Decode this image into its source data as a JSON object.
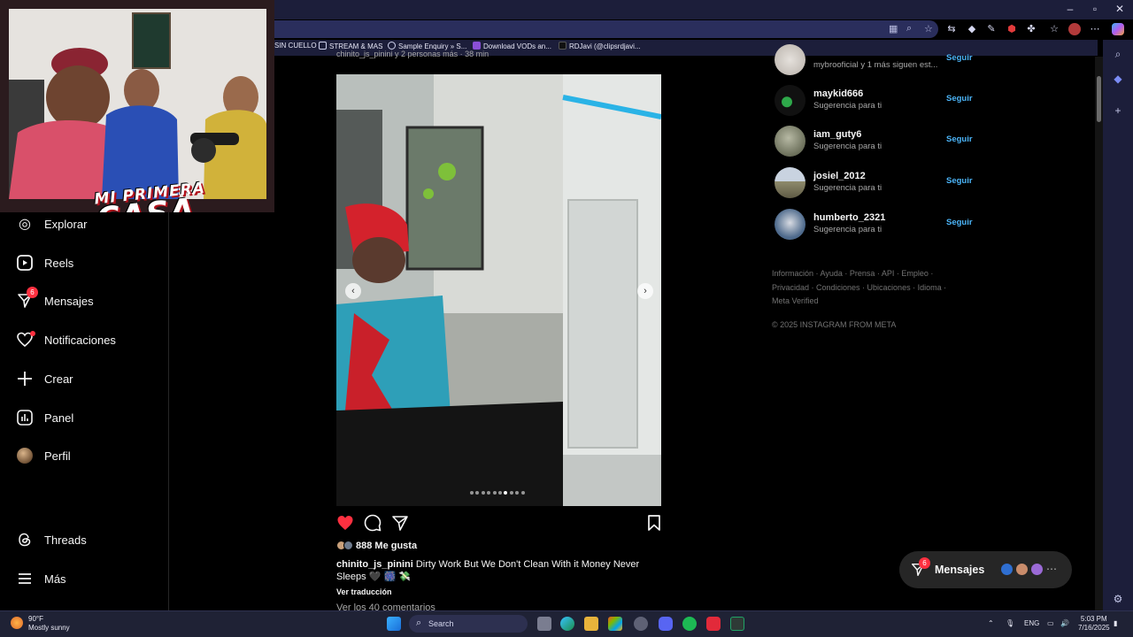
{
  "bookmarks": [
    {
      "label": "SIN CUELLO"
    },
    {
      "label": "STREAM & MAS"
    },
    {
      "label": "Sample Enquiry » S..."
    },
    {
      "label": "Download VODs an..."
    },
    {
      "label": "RDJavi (@clipsrdjavi..."
    }
  ],
  "overlay": {
    "logo_line1": "MI PRIMERA",
    "logo_line2": "CASA"
  },
  "nav": {
    "items": [
      {
        "label": "Explorar",
        "icon": "compass-icon"
      },
      {
        "label": "Reels",
        "icon": "reels-icon"
      },
      {
        "label": "Mensajes",
        "icon": "messenger-icon",
        "badge": "6"
      },
      {
        "label": "Notificaciones",
        "icon": "heart-icon"
      },
      {
        "label": "Crear",
        "icon": "plus-icon"
      },
      {
        "label": "Panel",
        "icon": "chart-icon"
      },
      {
        "label": "Perfil",
        "icon": "avatar"
      },
      {
        "label": "Threads",
        "icon": "threads-icon"
      },
      {
        "label": "Más",
        "icon": "menu-icon"
      }
    ]
  },
  "post": {
    "header": "chinito_js_pinini y 2 personas más · 38 min",
    "likes": "888 Me gusta",
    "username": "chinito_js_pinini",
    "caption": "Dirty Work But We Don't Clean With it Money Never Sleeps 🖤 🎆 💸",
    "translate": "Ver traducción",
    "comments": "Ver los 40 comentarios",
    "carousel_count": 10,
    "carousel_active": 6,
    "liked": true
  },
  "suggestions": {
    "follow_label": "Seguir",
    "items": [
      {
        "name": "",
        "sub": "mybrooficial y 1 más siguen est..."
      },
      {
        "name": "maykid666",
        "sub": "Sugerencia para ti"
      },
      {
        "name": "iam_guty6",
        "sub": "Sugerencia para ti"
      },
      {
        "name": "josiel_2012",
        "sub": "Sugerencia para ti"
      },
      {
        "name": "humberto_2321",
        "sub": "Sugerencia para ti"
      }
    ]
  },
  "footer": {
    "line1": "Información · Ayuda · Prensa · API · Empleo ·",
    "line2": "Privacidad · Condiciones · Ubicaciones · Idioma ·",
    "line3": "Meta Verified",
    "copyright": "© 2025 INSTAGRAM FROM META"
  },
  "messages_float": {
    "label": "Mensajes",
    "badge": "6"
  },
  "taskbar": {
    "temp": "90°F",
    "weather": "Mostly sunny",
    "search": "Search",
    "lang": "ENG",
    "time": "5:03 PM",
    "date": "7/16/2025"
  }
}
